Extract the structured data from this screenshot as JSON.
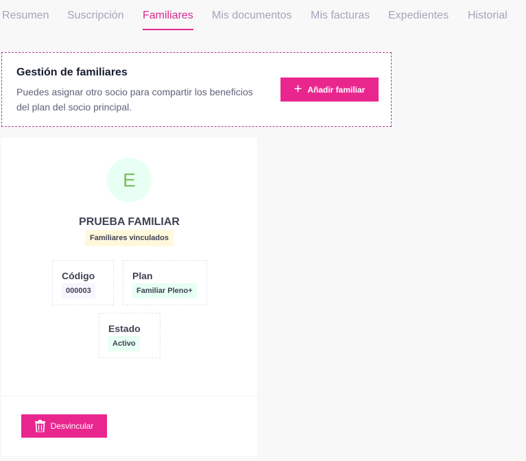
{
  "tabs": [
    {
      "label": "Resumen"
    },
    {
      "label": "Suscripción"
    },
    {
      "label": "Familiares",
      "active": true
    },
    {
      "label": "Mis documentos"
    },
    {
      "label": "Mis facturas"
    },
    {
      "label": "Expedientes"
    },
    {
      "label": "Historial"
    }
  ],
  "management": {
    "title": "Gestión de familiares",
    "description": "Puedes asignar otro socio para compartir los beneficios del plan del socio principal.",
    "add_button_label": "Añadir familiar",
    "add_button_icon": "plus-icon"
  },
  "member_card": {
    "avatar_initial": "E",
    "name": "PRUEBA FAMILIAR",
    "badge": "Familiares vinculados",
    "fields": {
      "code": {
        "label": "Código",
        "value": "000003"
      },
      "plan": {
        "label": "Plan",
        "value": "Familiar Pleno+"
      },
      "state": {
        "label": "Estado",
        "value": "Activo"
      }
    },
    "unlink_button_label": "Desvincular",
    "unlink_button_icon": "trash-icon"
  },
  "colors": {
    "accent": "#e9268e",
    "tab_inactive": "#a8a2b9",
    "avatar_bg": "#e8fff3",
    "avatar_text": "#7dbd5c",
    "badge_bg": "#fff8dd"
  }
}
